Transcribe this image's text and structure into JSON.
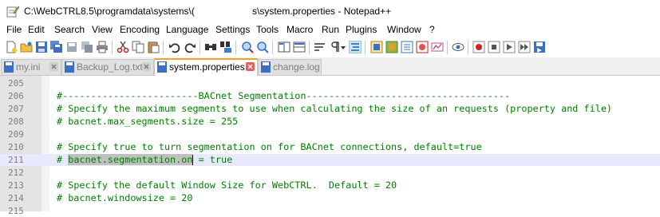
{
  "window": {
    "title_part1": "C:\\WebCTRL8.5\\programdata\\systems\\(",
    "title_part2": "s\\system.properties - Notepad++"
  },
  "menu": [
    "File",
    "Edit",
    "Search",
    "View",
    "Encoding",
    "Language",
    "Settings",
    "Tools",
    "Macro",
    "Run",
    "Plugins",
    "Window",
    "?"
  ],
  "toolbar": {
    "icons": [
      "new-file-icon",
      "open-file-icon",
      "save-icon",
      "save-all-icon",
      "close-icon",
      "close-all-icon",
      "print-icon",
      "cut-icon",
      "copy-icon",
      "paste-icon",
      "undo-icon",
      "redo-icon",
      "find-icon",
      "replace-icon",
      "zoom-in-icon",
      "zoom-out-icon",
      "sync-vertical-icon",
      "sync-horizontal-icon",
      "word-wrap-icon",
      "show-all-chars-icon",
      "indent-guide-icon",
      "user-language-icon",
      "document-map-icon",
      "function-list-icon",
      "folder-workspace-icon",
      "monitoring-icon",
      "record-macro-icon",
      "stop-record-icon",
      "play-macro-icon",
      "run-macro-multiple-icon",
      "save-macro-icon"
    ]
  },
  "tabs": [
    {
      "label": "my.ini",
      "active": false
    },
    {
      "label": "Backup_Log.txt",
      "active": false
    },
    {
      "label": "system.properties",
      "active": true
    },
    {
      "label": "change.log",
      "active": false
    }
  ],
  "editor": {
    "lines": [
      {
        "num": "205",
        "text": ""
      },
      {
        "num": "206",
        "text": "#------------------------BACnet Segmentation------------------------------------"
      },
      {
        "num": "207",
        "text": "# Specify the maximum segments to use when calculating the size of an requests (property and file)"
      },
      {
        "num": "208",
        "text": "# bacnet.max_segments.size = 255"
      },
      {
        "num": "209",
        "text": ""
      },
      {
        "num": "210",
        "text": "# Specify true to turn segmentation on for BACnet connections, default=true"
      },
      {
        "num": "211",
        "text_prefix": "# ",
        "text_selected": "bacnet.segmentation.on",
        "text_suffix": " = true",
        "current": true
      },
      {
        "num": "212",
        "text": ""
      },
      {
        "num": "213",
        "text": "# Specify the default Window Size for WebCTRL.  Default = 20"
      },
      {
        "num": "214",
        "text": "# bacnet.windowsize = 20"
      },
      {
        "num": "215",
        "text": ""
      }
    ]
  }
}
